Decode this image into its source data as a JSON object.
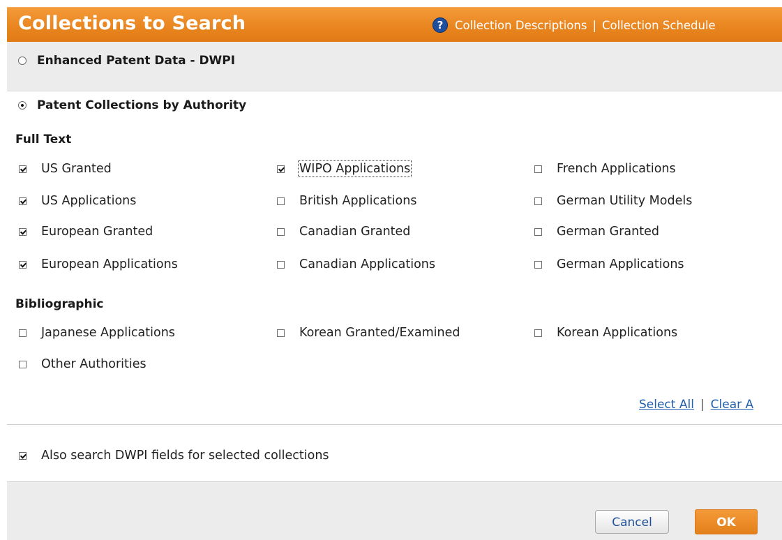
{
  "header": {
    "title": "Collections to Search",
    "help_icon": "help-icon",
    "links": [
      "Collection Descriptions",
      "Collection Schedule"
    ],
    "separator": "|"
  },
  "dwpi_option": {
    "label": "Enhanced Patent Data - DWPI",
    "selected": false
  },
  "authority_option": {
    "label": "Patent Collections by Authority",
    "selected": true
  },
  "full_text": {
    "heading": "Full Text",
    "items": [
      {
        "label": "US Granted",
        "checked": true
      },
      {
        "label": "WIPO Applications",
        "checked": true
      },
      {
        "label": "French Applications",
        "checked": false
      },
      {
        "label": "US Applications",
        "checked": true
      },
      {
        "label": "British Applications",
        "checked": false
      },
      {
        "label": "German Utility Models",
        "checked": false
      },
      {
        "label": "European Granted",
        "checked": true
      },
      {
        "label": "Canadian Granted",
        "checked": false
      },
      {
        "label": "German Granted",
        "checked": false
      },
      {
        "label": "European Applications",
        "checked": true
      },
      {
        "label": "Canadian Applications",
        "checked": false
      },
      {
        "label": "German Applications",
        "checked": false
      }
    ]
  },
  "bibliographic": {
    "heading": "Bibliographic",
    "items": [
      {
        "label": "Japanese Applications",
        "checked": false
      },
      {
        "label": "Korean Granted/Examined",
        "checked": false
      },
      {
        "label": "Korean Applications",
        "checked": false
      },
      {
        "label": "Other Authorities",
        "checked": false
      }
    ]
  },
  "footer_links": {
    "select_all": "Select All",
    "clear_all": "Clear A",
    "separator": "|"
  },
  "dwpi_fields": {
    "label": "Also search DWPI fields for selected collections",
    "checked": true
  },
  "buttons": {
    "cancel": "Cancel",
    "ok": "OK"
  }
}
